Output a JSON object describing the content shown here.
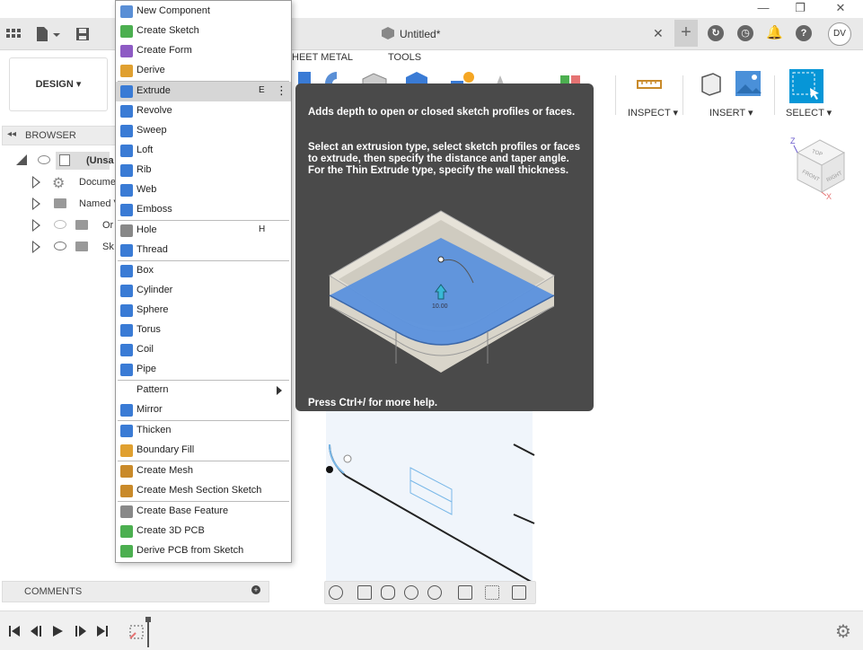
{
  "window": {
    "minimize": "—",
    "restore": "❐",
    "close": "✕"
  },
  "tabs": {
    "document_title": "Untitled*",
    "avatar_initials": "DV"
  },
  "toolbar": {
    "workspace": "DESIGN",
    "tab_sheet_metal": "HEET METAL",
    "tab_tools": "TOOLS",
    "inspect": "INSPECT",
    "insert": "INSERT",
    "select": "SELECT"
  },
  "browser": {
    "title": "BROWSER",
    "items": [
      {
        "label": "(Unsa"
      },
      {
        "label": "Docume"
      },
      {
        "label": "Named V"
      },
      {
        "label": "Or"
      },
      {
        "label": "Sk"
      }
    ]
  },
  "menu": {
    "items": [
      {
        "label": "New Component",
        "icon": "new-component-icon",
        "color": "#5a8fd6"
      },
      {
        "label": "Create Sketch",
        "icon": "create-sketch-icon",
        "color": "#4caf50"
      },
      {
        "label": "Create Form",
        "icon": "create-form-icon",
        "color": "#8e5bc4"
      },
      {
        "label": "Derive",
        "icon": "derive-icon",
        "color": "#e0a030"
      },
      {
        "label": "Extrude",
        "icon": "extrude-icon",
        "color": "#3a7bd5",
        "shortcut": "E",
        "more": "⋮"
      },
      {
        "label": "Revolve",
        "icon": "revolve-icon",
        "color": "#3a7bd5"
      },
      {
        "label": "Sweep",
        "icon": "sweep-icon",
        "color": "#3a7bd5"
      },
      {
        "label": "Loft",
        "icon": "loft-icon",
        "color": "#3a7bd5"
      },
      {
        "label": "Rib",
        "icon": "rib-icon",
        "color": "#3a7bd5"
      },
      {
        "label": "Web",
        "icon": "web-icon",
        "color": "#3a7bd5"
      },
      {
        "label": "Emboss",
        "icon": "emboss-icon",
        "color": "#3a7bd5"
      },
      {
        "label": "Hole",
        "icon": "hole-icon",
        "color": "#888888",
        "shortcut": "H"
      },
      {
        "label": "Thread",
        "icon": "thread-icon",
        "color": "#3a7bd5"
      },
      {
        "label": "Box",
        "icon": "box-icon",
        "color": "#3a7bd5"
      },
      {
        "label": "Cylinder",
        "icon": "cylinder-icon",
        "color": "#3a7bd5"
      },
      {
        "label": "Sphere",
        "icon": "sphere-icon",
        "color": "#3a7bd5"
      },
      {
        "label": "Torus",
        "icon": "torus-icon",
        "color": "#3a7bd5"
      },
      {
        "label": "Coil",
        "icon": "coil-icon",
        "color": "#3a7bd5"
      },
      {
        "label": "Pipe",
        "icon": "pipe-icon",
        "color": "#3a7bd5"
      },
      {
        "label": "Pattern",
        "submenu": true
      },
      {
        "label": "Mirror",
        "icon": "mirror-icon",
        "color": "#3a7bd5"
      },
      {
        "label": "Thicken",
        "icon": "thicken-icon",
        "color": "#3a7bd5"
      },
      {
        "label": "Boundary Fill",
        "icon": "boundary-fill-icon",
        "color": "#e0a030"
      },
      {
        "label": "Create Mesh",
        "icon": "create-mesh-icon",
        "color": "#c98a2a"
      },
      {
        "label": "Create Mesh Section Sketch",
        "icon": "create-mesh-section-sketch-icon",
        "color": "#c98a2a"
      },
      {
        "label": "Create Base Feature",
        "icon": "create-base-feature-icon",
        "color": "#888888"
      },
      {
        "label": "Create 3D PCB",
        "icon": "create-3d-pcb-icon",
        "color": "#4caf50"
      },
      {
        "label": "Derive PCB from Sketch",
        "icon": "derive-pcb-icon",
        "color": "#4caf50"
      }
    ]
  },
  "tooltip": {
    "title": "Adds depth to open or closed sketch profiles or faces.",
    "body": "Select an extrusion type, select sketch profiles or faces to extrude, then specify the distance and taper angle. For the Thin Extrude type, specify the wall thickness.",
    "dimension": "10.00",
    "footer": "Press Ctrl+/ for more help."
  },
  "viewcube": {
    "top": "TOP",
    "front": "FRONT",
    "right": "RIGHT",
    "axis_z": "Z",
    "axis_x": "X"
  },
  "comments": {
    "title": "COMMENTS"
  },
  "colors": {
    "accent": "#0696d7",
    "tooltip_bg": "#4a4a4a",
    "highlight": "#d6d6d6"
  }
}
